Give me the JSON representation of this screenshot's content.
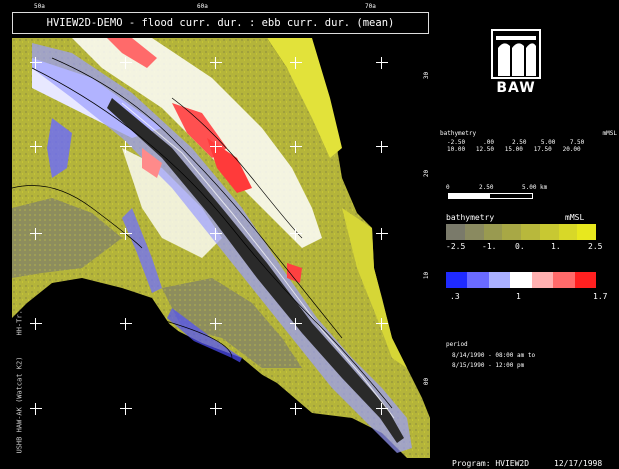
{
  "title": "HVIEW2D-DEMO - flood curr. dur. : ebb curr. dur. (mean)",
  "logo": {
    "text": "BAW"
  },
  "top_ticks": [
    "50a",
    "60a",
    "70a"
  ],
  "right_ticks": [
    "30",
    "20",
    "10",
    "00",
    "50"
  ],
  "left_vertical_text": "USHB HAW-AK (Watcat K2)     HH-Tr. mean 2/1 2/1.grm",
  "bathy_small_table": {
    "header": "bathymetry                                   mMSL",
    "row1": "-2.50     .00     2.50    5.00    7.50",
    "row2": "10.00   12.50   15.00   17.50   20.00"
  },
  "scale_bar": {
    "labels": [
      "0",
      "2.50",
      "5.00 km"
    ]
  },
  "bathymetry_legend": {
    "title": "bathymetry",
    "unit": "mMSL",
    "colors": [
      "#7a7a6a",
      "#8a8a60",
      "#999a50",
      "#a8a845",
      "#b8b83c",
      "#c8c832",
      "#d8d828",
      "#e8e81e"
    ],
    "tick_labels": [
      "-2.5",
      "-1.",
      "0.",
      "1.",
      "2.5"
    ]
  },
  "ratio_legend": {
    "colors": [
      "#1f2aff",
      "#6a6aff",
      "#aab0ff",
      "#ffffff",
      "#ffb0b0",
      "#ff6a6a",
      "#ff2020"
    ],
    "tick_labels": [
      ".3",
      "1",
      "1.7"
    ]
  },
  "period": {
    "label": "period",
    "line1": "8/14/1990 - 08:00 am to",
    "line2": "8/15/1990 - 12:00 pm"
  },
  "footer": {
    "program": "Program: HVIEW2D",
    "date": "12/17/1998"
  },
  "grid_crosses": [
    [
      30,
      57
    ],
    [
      120,
      57
    ],
    [
      210,
      57
    ],
    [
      290,
      57
    ],
    [
      376,
      57
    ],
    [
      30,
      141
    ],
    [
      120,
      141
    ],
    [
      210,
      141
    ],
    [
      290,
      141
    ],
    [
      376,
      141
    ],
    [
      30,
      228
    ],
    [
      120,
      228
    ],
    [
      210,
      228
    ],
    [
      290,
      228
    ],
    [
      376,
      228
    ],
    [
      30,
      318
    ],
    [
      120,
      318
    ],
    [
      210,
      318
    ],
    [
      290,
      318
    ],
    [
      376,
      318
    ],
    [
      30,
      403
    ],
    [
      120,
      403
    ],
    [
      210,
      403
    ],
    [
      290,
      403
    ],
    [
      376,
      403
    ]
  ]
}
